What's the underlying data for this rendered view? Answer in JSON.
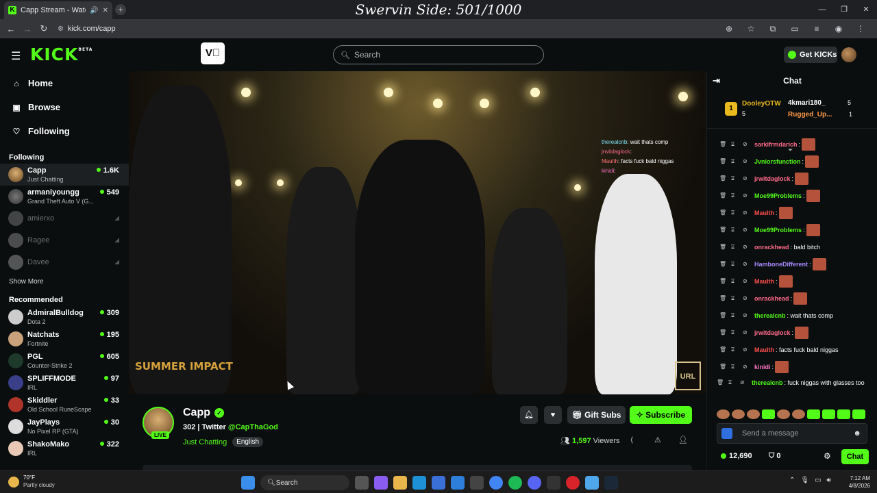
{
  "browser": {
    "tab_title": "Capp Stream - Watch Live o",
    "overlay_title": "Swervin Side: 501/1000",
    "url": "kick.com/capp"
  },
  "topnav": {
    "logo": "KICK",
    "logo_badge": "BETA",
    "search_placeholder": "Search",
    "get_kicks": "Get KICKs"
  },
  "sidebar": {
    "nav": [
      {
        "label": "Home",
        "icon": "home-icon"
      },
      {
        "label": "Browse",
        "icon": "browse-icon"
      },
      {
        "label": "Following",
        "icon": "heart-icon"
      }
    ],
    "following_title": "Following",
    "following": [
      {
        "name": "Capp",
        "sub": "Just Chatting",
        "count": "1.6K",
        "live": true
      },
      {
        "name": "armaniyoungg",
        "sub": "Grand Theft Auto V (G...",
        "count": "549",
        "live": true
      },
      {
        "name": "amierxo",
        "sub": "",
        "count": "",
        "live": false
      },
      {
        "name": "Ragee",
        "sub": "",
        "count": "",
        "live": false
      },
      {
        "name": "Davee",
        "sub": "",
        "count": "",
        "live": false
      }
    ],
    "show_more": "Show More",
    "recommended_title": "Recommended",
    "recommended": [
      {
        "name": "AdmiralBulldog",
        "sub": "Dota 2",
        "count": "309"
      },
      {
        "name": "Natchats",
        "sub": "Fortnite",
        "count": "195"
      },
      {
        "name": "PGL",
        "sub": "Counter-Strike 2",
        "count": "605"
      },
      {
        "name": "SPLIFFMODE",
        "sub": "IRL",
        "count": "97"
      },
      {
        "name": "Skiddler",
        "sub": "Old School RuneScape",
        "count": "33"
      },
      {
        "name": "JayPlays",
        "sub": "No Pixel RP (GTA)",
        "count": "30"
      },
      {
        "name": "ShakoMako",
        "sub": "IRL",
        "count": "322"
      }
    ]
  },
  "video": {
    "logo_left": "SUMMER IMPACT",
    "logo_right": "URL",
    "overlay_chat": [
      {
        "user": "therealcnb",
        "text": ": wait thats comp"
      },
      {
        "user": "jrwitdaglock",
        "text": ":"
      },
      {
        "user": "Maulth",
        "text": ": facts fuck bald niggas"
      },
      {
        "user": "kinidi",
        "text": ":"
      }
    ]
  },
  "stream": {
    "name": "Capp",
    "live_badge": "LIVE",
    "title_prefix": "302 | Twitter ",
    "twitter": "@CapThaGod",
    "category": "Just Chatting",
    "language": "English",
    "gift_subs": "Gift Subs",
    "subscribe": "Subscribe",
    "viewers_count": "1,597",
    "viewers_label": "Viewers"
  },
  "chat": {
    "title": "Chat",
    "pinned": {
      "first": {
        "rank": "1",
        "user": "DooleyOTW",
        "count": "5"
      },
      "second": {
        "user": "4kmari180_",
        "count": "5"
      },
      "third": {
        "user": "Rugged_Up...",
        "count": "1"
      }
    },
    "messages": [
      {
        "user": "sarkifrmdarich",
        "text": ":",
        "color": "#ff6a8a",
        "emote": true
      },
      {
        "user": "Jvniorsfunction",
        "text": ":",
        "color": "#53fc18",
        "emote": true
      },
      {
        "user": "jrwitdaglock",
        "text": ":",
        "color": "#ff6a8a",
        "emote": true
      },
      {
        "user": "Moe99Problems",
        "text": ":",
        "color": "#53fc18",
        "emote": true
      },
      {
        "user": "Maulth",
        "text": ":",
        "color": "#ff4f4f",
        "emote": true
      },
      {
        "user": "Moe99Problems",
        "text": ":",
        "color": "#53fc18",
        "emote": true
      },
      {
        "user": "onrackhead",
        "text": ": bald bitch",
        "color": "#ff6a8a",
        "emote": false
      },
      {
        "user": "HamboneDifferent",
        "text": ":",
        "color": "#a98bff",
        "emote": true
      },
      {
        "user": "Maulth",
        "text": ":",
        "color": "#ff4f4f",
        "emote": true
      },
      {
        "user": "onrackhead",
        "text": ":",
        "color": "#ff6a8a",
        "emote": true
      },
      {
        "user": "therealcnb",
        "text": ": wait thats comp",
        "color": "#53fc18",
        "emote": false
      },
      {
        "user": "jrwitdaglock",
        "text": ":",
        "color": "#ff6a8a",
        "emote": true
      },
      {
        "user": "Maulth",
        "text": ": facts fuck bald niggas",
        "color": "#ff4f4f",
        "emote": false
      },
      {
        "user": "kinidi",
        "text": ":",
        "color": "#ff73c6",
        "emote": true
      }
    ],
    "last_message": {
      "user": "therealcnb",
      "text": ": fuck niggas with glasses too"
    },
    "input_placeholder": "Send a message",
    "kicks_balance": "12,690",
    "points": "0",
    "chat_button": "Chat"
  },
  "taskbar": {
    "temp": "70°F",
    "weather": "Partly cloudy",
    "search": "Search",
    "time": "7:12 AM",
    "date": "4/8/2026"
  }
}
